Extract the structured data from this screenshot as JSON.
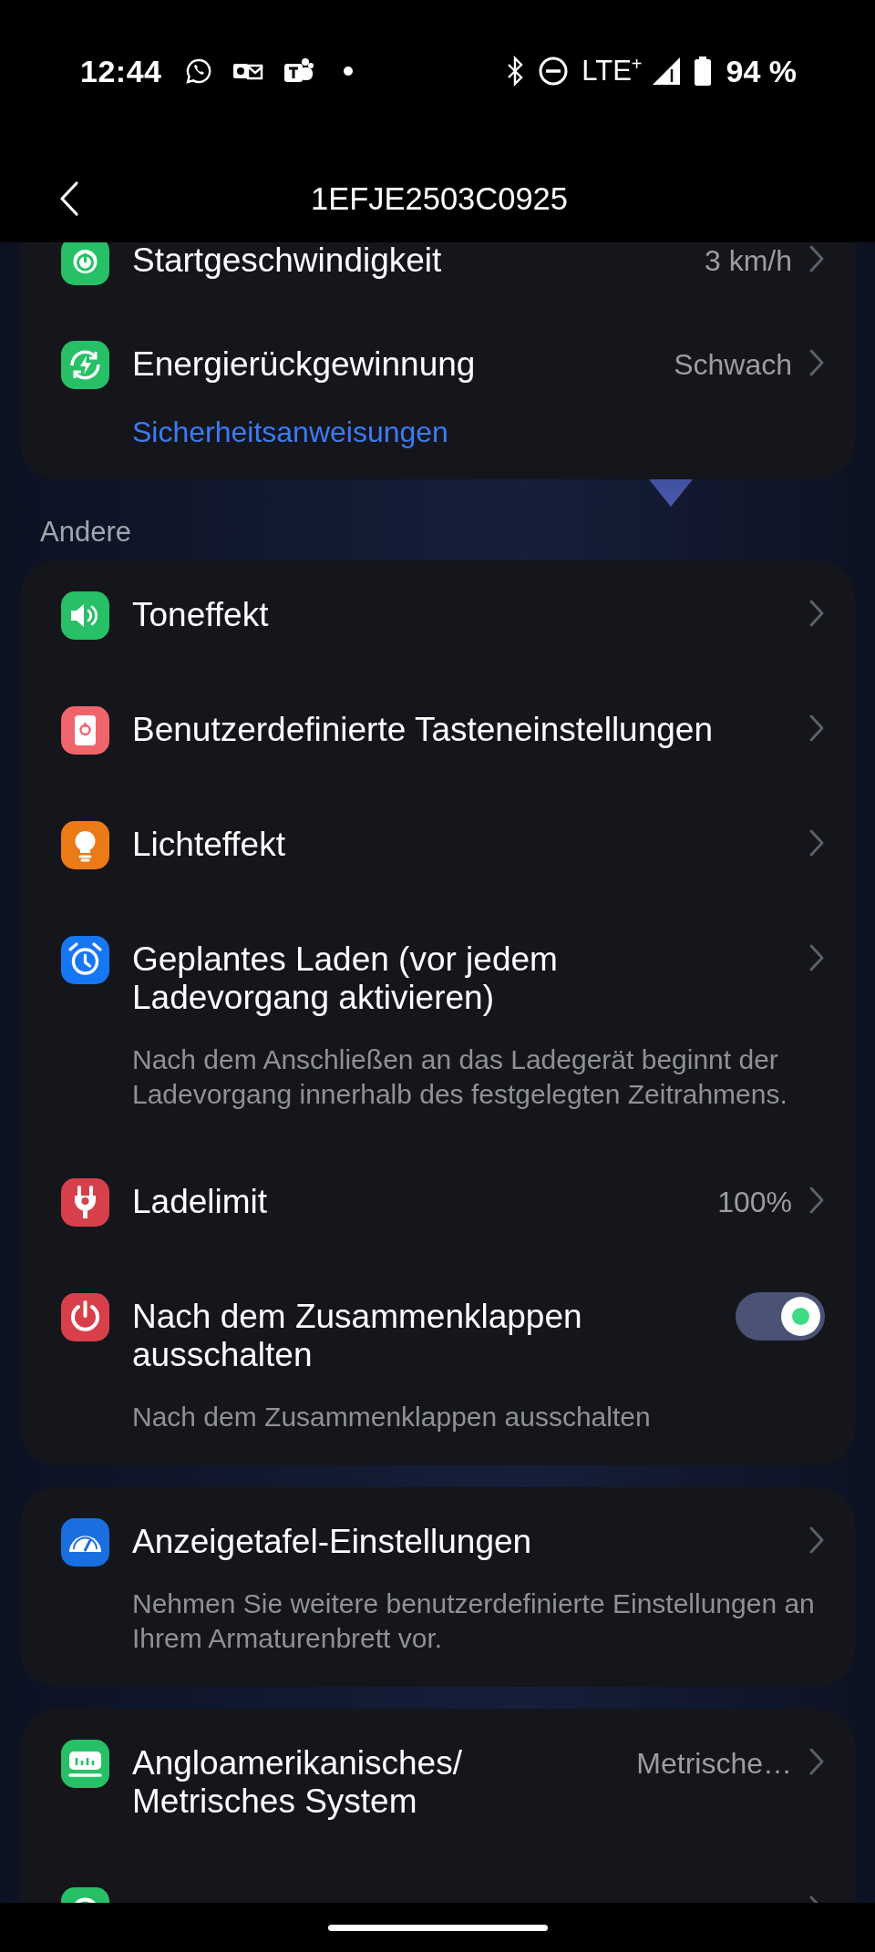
{
  "status_bar": {
    "time": "12:44",
    "network": "LTE$^{+}$",
    "battery": "94 %"
  },
  "header": {
    "title": "1EFJE2503C0925"
  },
  "blocks": [
    {
      "kind": "card",
      "rows": [
        {
          "kind": "nav",
          "label": "Startgeschwindigkeit",
          "value": "3 km/h"
        },
        {
          "kind": "nav",
          "label": "Energierückgewinnung",
          "value": "Schwach"
        }
      ],
      "link": "Sicherheitsanweisungen"
    },
    {
      "kind": "heading",
      "text": "Andere"
    },
    {
      "kind": "card",
      "rows": [
        {
          "kind": "nav",
          "label": "Toneffekt"
        },
        {
          "kind": "nav",
          "label": "Benutzerdefinierte Tasteneinstellungen"
        },
        {
          "kind": "nav",
          "label": "Lichteffekt"
        },
        {
          "kind": "nav",
          "label": "Geplantes Laden (vor jedem Ladevorgang aktivieren)",
          "description": "Nach dem Anschließen an das Ladegerät beginnt der Ladevorgang innerhalb des festgelegten Zeitrahmens."
        },
        {
          "kind": "nav",
          "label": "Ladelimit",
          "value": "100%"
        },
        {
          "kind": "toggle",
          "label": "Nach dem Zusammenklappen ausschalten",
          "on": true,
          "description": "Nach dem Zusammenklappen ausschalten"
        }
      ]
    },
    {
      "kind": "card",
      "rows": [
        {
          "kind": "nav",
          "label": "Anzeigetafel-Einstellungen",
          "description": "Nehmen Sie weitere benutzerdefinierte Einstellungen an Ihrem Armaturenbrett vor."
        }
      ]
    },
    {
      "kind": "card",
      "rows": [
        {
          "kind": "nav",
          "label": "Angloamerikanisches/ Metrisches System",
          "value": "Metrische…"
        },
        {
          "kind": "nav"
        }
      ]
    }
  ]
}
